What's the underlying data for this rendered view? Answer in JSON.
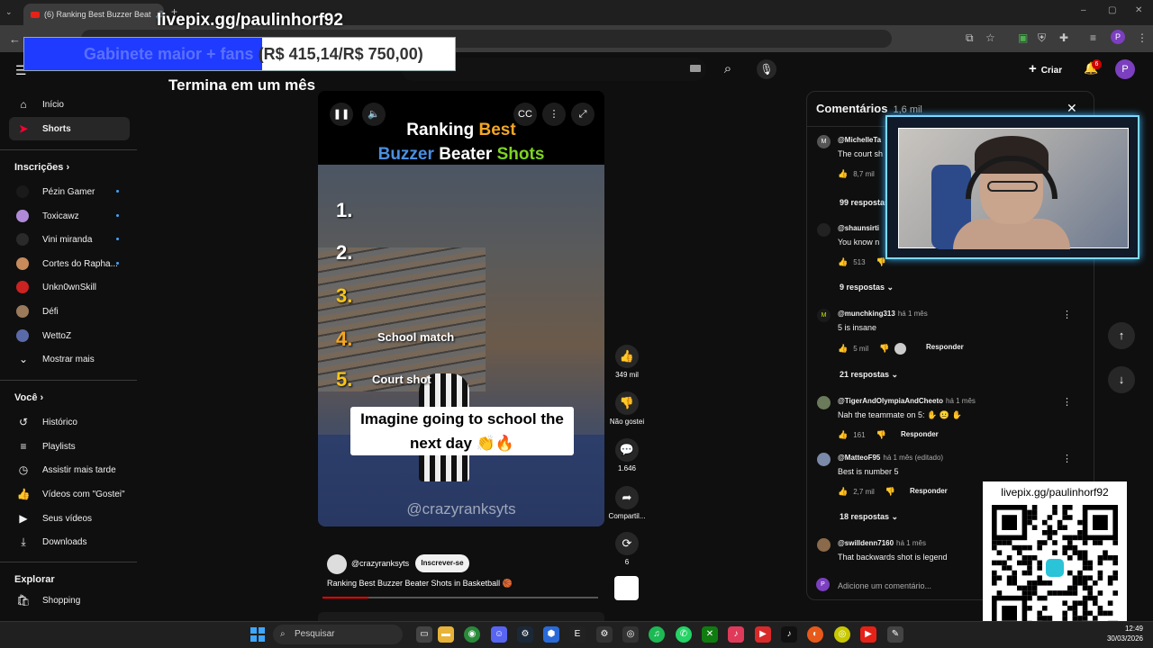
{
  "browser": {
    "tab_title": "(6) Ranking Best Buzzer Beat",
    "new_tab": "+"
  },
  "overlays": {
    "livepix_top": "livepix.gg/paulinhorf92",
    "goal_label": "Gabinete maior + fans",
    "goal_amount": "(R$ 415,14/R$ 750,00)",
    "goal_fraction": 0.553,
    "goal_ends": "Termina em um mês",
    "qr_title": "livepix.gg/paulinhorf92"
  },
  "youtube": {
    "logo": "YouTube",
    "create": "Criar",
    "notifications": "6",
    "avatar_letter": "P"
  },
  "sidebar": {
    "main": [
      {
        "label": "Início",
        "icon": "home-icon"
      },
      {
        "label": "Shorts",
        "icon": "shorts-icon"
      }
    ],
    "subs_title": "Inscrições",
    "subs": [
      {
        "label": "Pézin Gamer",
        "color": "#1a1a1a"
      },
      {
        "label": "Toxicawz",
        "color": "#b08ad8"
      },
      {
        "label": "Vini miranda",
        "color": "#2a2a2a"
      },
      {
        "label": "Cortes do Rapha...",
        "color": "#c78a5a"
      },
      {
        "label": "Unkn0wnSkill",
        "color": "#cc2222"
      },
      {
        "label": "Défi",
        "color": "#9a7a5a"
      },
      {
        "label": "WettoZ",
        "color": "#5a6aa8"
      }
    ],
    "show_more": "Mostrar mais",
    "you_title": "Você",
    "you": [
      {
        "label": "Histórico",
        "icon": "history-icon"
      },
      {
        "label": "Playlists",
        "icon": "playlists-icon"
      },
      {
        "label": "Assistir mais tarde",
        "icon": "watch-later-icon"
      },
      {
        "label": "Vídeos com \"Gostei\"",
        "icon": "liked-icon"
      },
      {
        "label": "Seus vídeos",
        "icon": "your-videos-icon"
      },
      {
        "label": "Downloads",
        "icon": "download-icon"
      }
    ],
    "explore_title": "Explorar",
    "explore": [
      {
        "label": "Shopping",
        "icon": "shopping-icon"
      }
    ]
  },
  "video": {
    "title_line1_a": "Ranking ",
    "title_line1_b": "Best",
    "title_line2_a": "Buzzer ",
    "title_line2_b": "Beater ",
    "title_line2_c": "Shots",
    "numbers": [
      "1.",
      "2.",
      "3.",
      "4.",
      "5."
    ],
    "label4": "School match",
    "label5": "Court shot",
    "caption": "Imagine going to school the next day 👏🔥",
    "watermark": "@crazyranksyts",
    "channel": "@crazyranksyts",
    "subscribe": "Inscrever-se",
    "meta_title": "Ranking Best Buzzer Beater Shots in Basketball 🏀",
    "progress": 0.167
  },
  "actions": {
    "likes": "349 mil",
    "dislike": "Não gostei",
    "comments": "1.646",
    "share": "Compartil...",
    "remix": "6"
  },
  "comments": {
    "title": "Comentários",
    "count": "1,6 mil",
    "items": [
      {
        "user": "@MichelleTa",
        "ago": "",
        "text": "The court sh",
        "likes": "8,7 mil",
        "replies": "99 respostas",
        "avatar": "M",
        "color": "#555"
      },
      {
        "user": "@shaunsirti",
        "ago": "",
        "text": "You know n",
        "likes": "513",
        "replies": "9 respostas",
        "avatar": "",
        "color": "#222"
      },
      {
        "user": "@munchking313",
        "ago": "há 1 mês",
        "text": "5 is insane",
        "likes": "5 mil",
        "replies": "21 respostas",
        "avatar": "M",
        "color": "#1a1a1a"
      },
      {
        "user": "@TigerAndOlympiaAndCheeto",
        "ago": "há 1 mês",
        "text": "Nah the teammate on 5: ✋ 😐 ✋",
        "likes": "161",
        "replies": "",
        "avatar": "",
        "color": "#6a7a5a"
      },
      {
        "user": "@MatteoF95",
        "ago": "há 1 mês (editado)",
        "text": "Best is number 5",
        "likes": "2,7 mil",
        "replies": "18 respostas",
        "avatar": "",
        "color": "#7a8aa8"
      },
      {
        "user": "@swilldenn7160",
        "ago": "há 1 mês",
        "text": "That backwards shot is legend",
        "likes": "",
        "replies": "",
        "avatar": "",
        "color": "#8a6a4a"
      }
    ],
    "reply": "Responder",
    "add_placeholder": "Adicione um comentário...",
    "input_avatar": "P"
  },
  "taskbar": {
    "search": "Pesquisar",
    "time": "12:49",
    "date": "30/03/2026"
  }
}
